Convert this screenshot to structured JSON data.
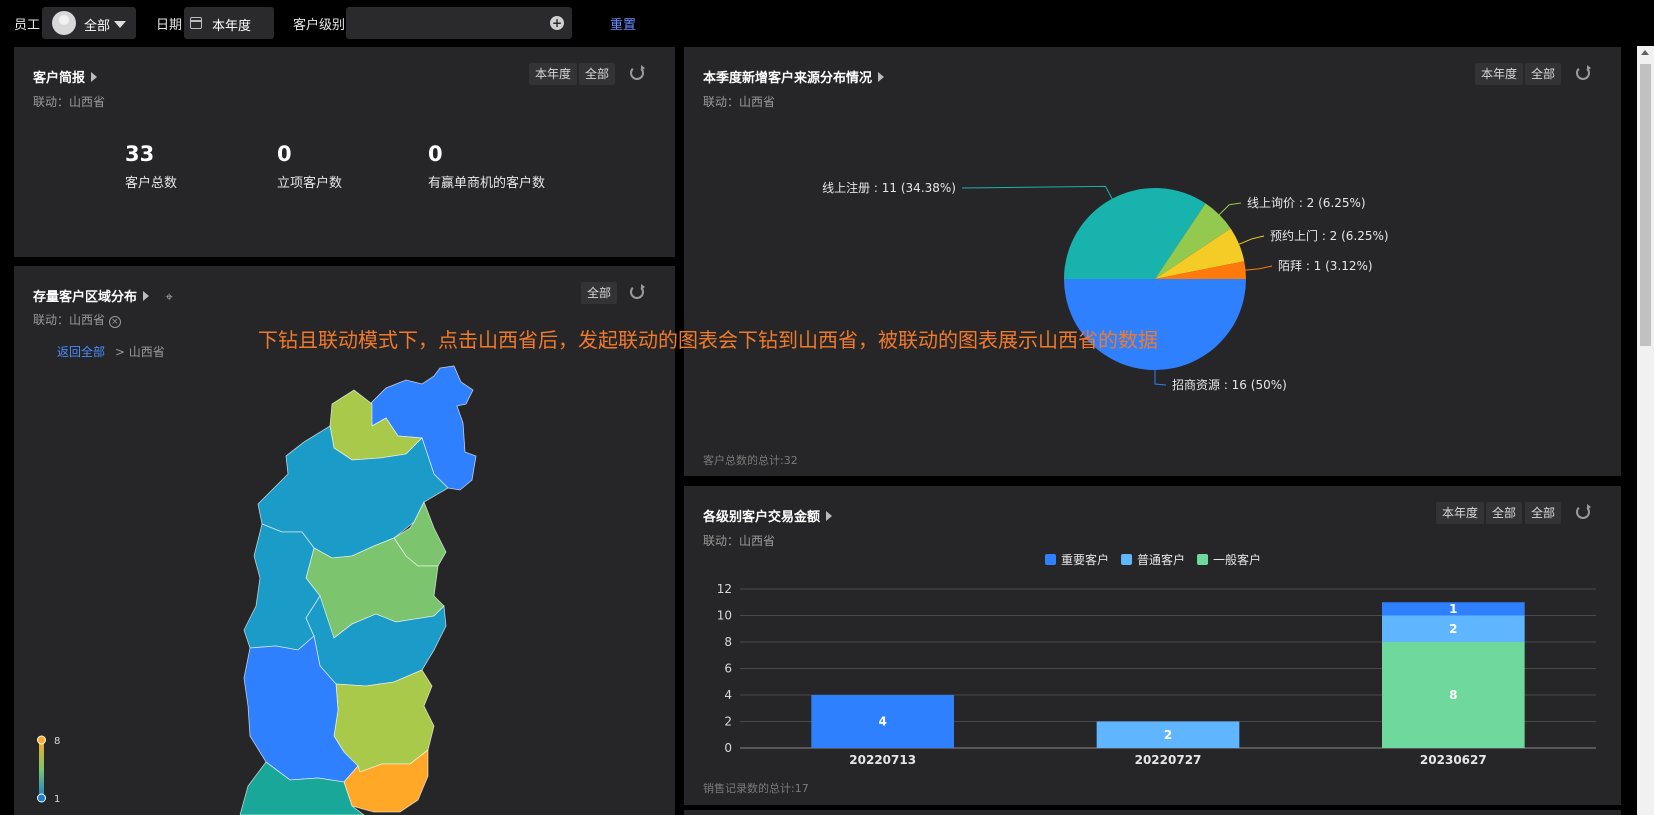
{
  "filters": {
    "employee_label": "员工",
    "employee_value": "全部",
    "date_label": "日期",
    "date_value": "本年度",
    "level_label": "客户级别",
    "level_value": "",
    "reset_label": "重置"
  },
  "panel_summary": {
    "title": "客户简报",
    "linkage": "联动：山西省",
    "chip_period": "本年度",
    "chip_scope": "全部",
    "kpis": [
      {
        "value": "33",
        "label": "客户总数"
      },
      {
        "value": "0",
        "label": "立项客户数"
      },
      {
        "value": "0",
        "label": "有赢单商机的客户数"
      }
    ]
  },
  "panel_map": {
    "title": "存量客户区域分布",
    "linkage": "联动：山西省",
    "chip_scope": "全部",
    "back_link": "返回全部",
    "crumb": "> 山西省",
    "legend_max": "8",
    "legend_min": "1"
  },
  "panel_source": {
    "title": "本季度新增客户来源分布情况",
    "linkage": "联动：山西省",
    "chip_period": "本年度",
    "chip_scope": "全部",
    "footer": "客户总数的总计:32"
  },
  "panel_amount": {
    "title": "各级别客户交易金额",
    "linkage": "联动：山西省",
    "chip_period": "本年度",
    "chip_scope1": "全部",
    "chip_scope2": "全部",
    "footer": "销售记录数的总计:17"
  },
  "overlay_text": "下钻且联动模式下，点击山西省后，发起联动的图表会下钻到山西省，被联动的图表展示山西省的数据",
  "colors": {
    "panel_bg": "#262628",
    "blue": "#2f80ff",
    "light_blue": "#5fb6ff",
    "green": "#6fd89c",
    "teal": "#17b3ac",
    "lime": "#93c94f",
    "yellow": "#f5cc26",
    "orange": "#ff7a0a",
    "overlay": "#f07a2a"
  },
  "chart_data": [
    {
      "type": "pie",
      "slices": [
        {
          "label": "线上注册 : 11 (34.38%)",
          "value": 11,
          "color": "#17b3ac"
        },
        {
          "label": "线上询价 : 2 (6.25%)",
          "value": 2,
          "color": "#93c94f"
        },
        {
          "label": "预约上门 : 2 (6.25%)",
          "value": 2,
          "color": "#f5cc26"
        },
        {
          "label": "陌拜 : 1 (3.12%)",
          "value": 1,
          "color": "#ff7a0a"
        },
        {
          "label": "招商资源 : 16 (50%)",
          "value": 16,
          "color": "#2f80ff"
        }
      ]
    },
    {
      "type": "bar",
      "stacked": true,
      "categories": [
        "20220713",
        "20220727",
        "20230627"
      ],
      "series": [
        {
          "name": "一般客户",
          "values": [
            0,
            0,
            8
          ],
          "color": "#6fd89c"
        },
        {
          "name": "普通客户",
          "values": [
            0,
            2,
            2
          ],
          "color": "#5fb6ff"
        },
        {
          "name": "重要客户",
          "values": [
            4,
            0,
            1
          ],
          "color": "#2f80ff"
        }
      ],
      "legend_order": [
        "重要客户",
        "普通客户",
        "一般客户"
      ],
      "ylim": [
        0,
        12
      ],
      "yticks": [
        0,
        2,
        4,
        6,
        8,
        10,
        12
      ],
      "grid": true,
      "legend": "top-center"
    }
  ]
}
